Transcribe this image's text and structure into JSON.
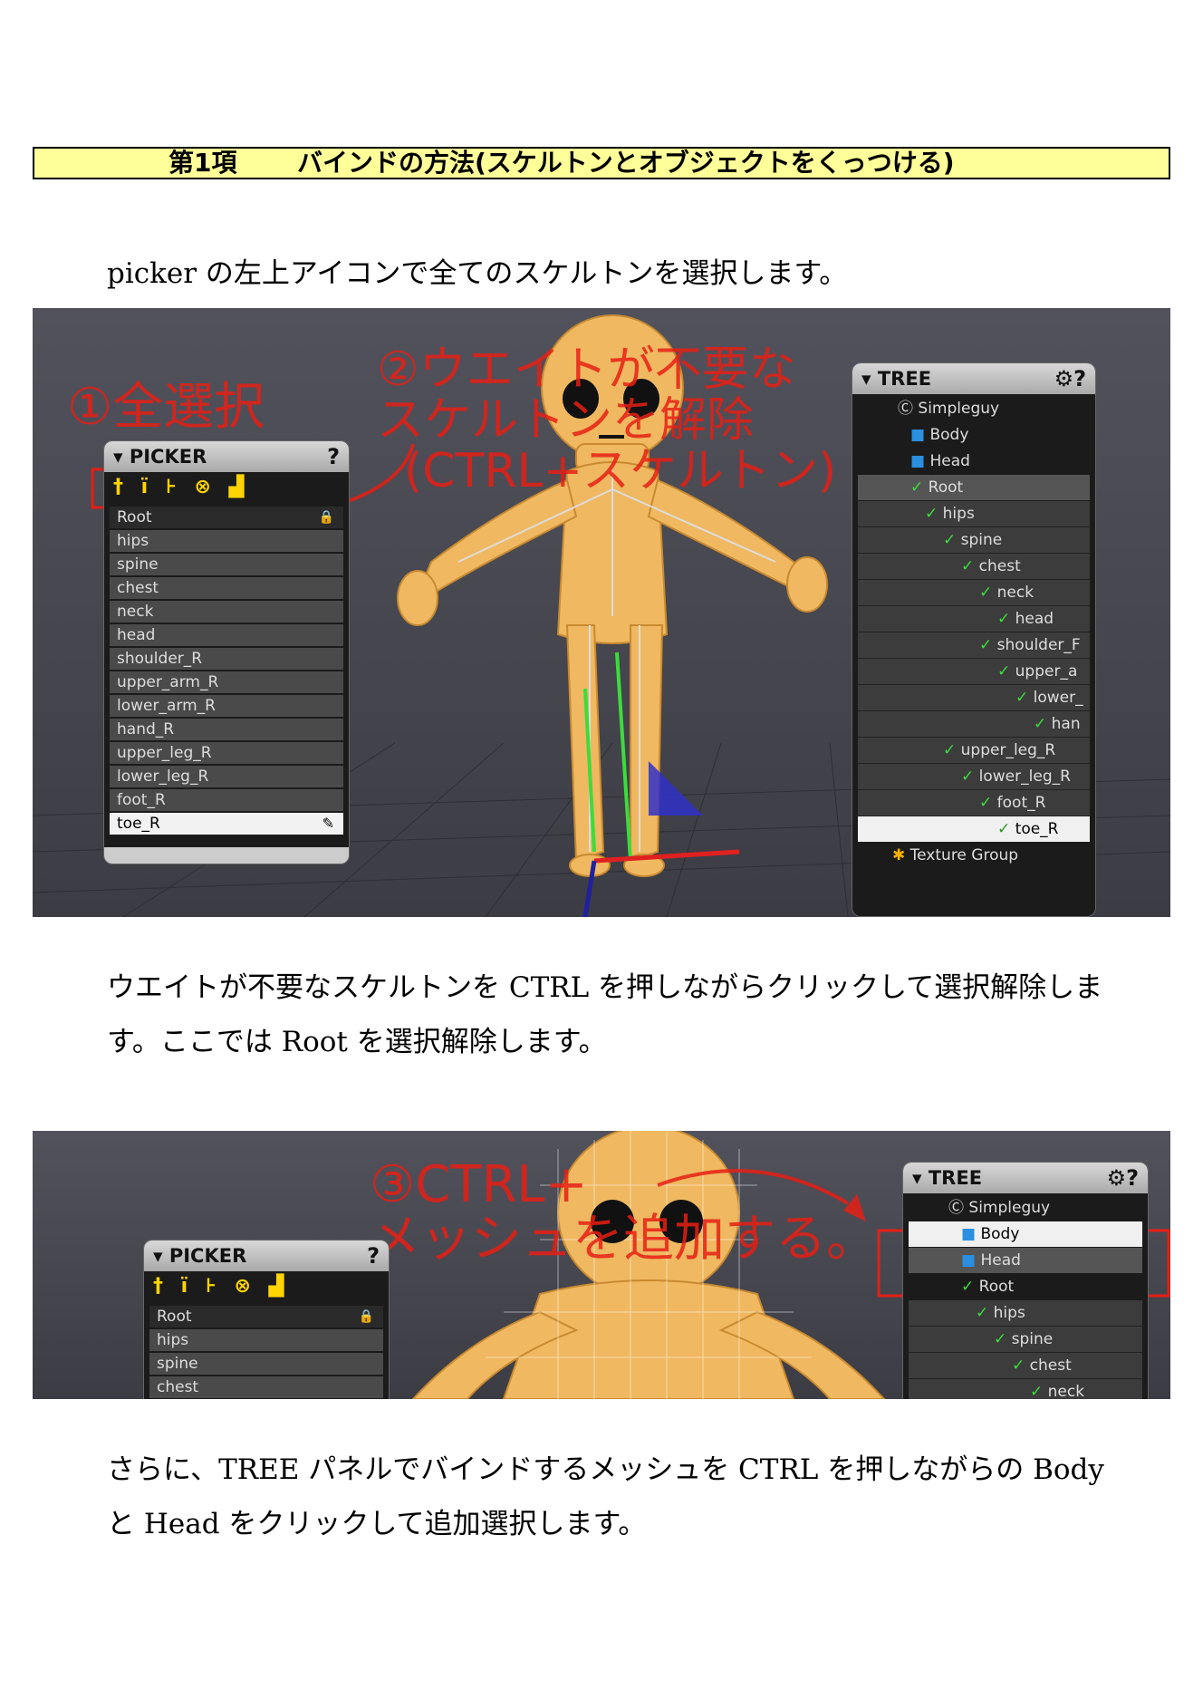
{
  "heading": {
    "number": "第1項",
    "title": "バインドの方法(スケルトンとオブジェクトをくっつける)"
  },
  "para1": "picker の左上アイコンで全てのスケルトンを選択します。",
  "para2_line1": "ウエイトが不要なスケルトンを CTRL を押しながらクリックして選択解除しま",
  "para2_line2": "す。ここでは Root を選択解除します。",
  "para3_line1": "さらに、TREE パネルでバインドするメッシュを CTRL を押しながらの Body",
  "para3_line2": "と Head をクリックして追加選択します。",
  "screenshot1": {
    "annotation1": "①全選択",
    "annotation2_line1": "②ウエイトが不要な",
    "annotation2_line2": "スケルトンを解除",
    "annotation2_line3": "(CTRL+スケルトン)",
    "picker": {
      "title": "▾ PICKER",
      "help": "?",
      "icons": "† ï ⊦ ⊗ ▟",
      "items": [
        "Root",
        "hips",
        "spine",
        "chest",
        "neck",
        "head",
        "shoulder_R",
        "upper_arm_R",
        "lower_arm_R",
        "hand_R",
        "upper_leg_R",
        "lower_leg_R",
        "foot_R",
        "toe_R"
      ]
    },
    "tree": {
      "title": "▾ TREE",
      "settings": "⚙?",
      "items": [
        "Simpleguy",
        "Body",
        "Head",
        "Root",
        "hips",
        "spine",
        "chest",
        "neck",
        "head",
        "shoulder_F",
        "upper_a",
        "lower_",
        "han",
        "upper_leg_R",
        "lower_leg_R",
        "foot_R",
        "toe_R",
        "Texture Group"
      ]
    }
  },
  "screenshot2": {
    "annotation3_line1": "③CTRL+",
    "annotation3_line2": "メッシュを追加する。",
    "picker": {
      "title": "▾ PICKER",
      "help": "?",
      "icons": "† ï ⊦ ⊗ ▟",
      "items": [
        "Root",
        "hips",
        "spine",
        "chest"
      ]
    },
    "tree": {
      "title": "▾ TREE",
      "settings": "⚙?",
      "items": [
        "Simpleguy",
        "Body",
        "Head",
        "Root",
        "hips",
        "spine",
        "chest",
        "neck"
      ]
    }
  },
  "colors": {
    "heading_bg": "#ffff99",
    "annotation": "#e61e14",
    "bone_green": "#3cdc3c",
    "mesh_blue": "#2a8fe0"
  }
}
